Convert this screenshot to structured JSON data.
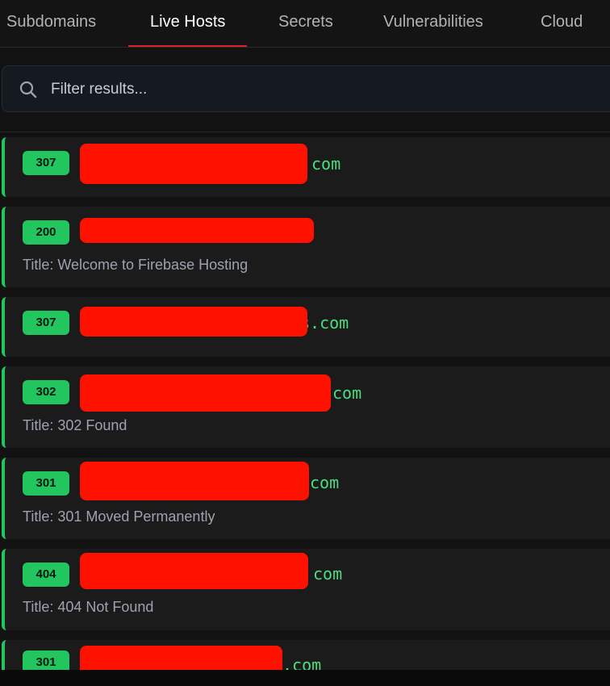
{
  "tabs": [
    {
      "label": "Subdomains",
      "active": false
    },
    {
      "label": "Live Hosts",
      "active": true
    },
    {
      "label": "Secrets",
      "active": false
    },
    {
      "label": "Vulnerabilities",
      "active": false
    },
    {
      "label": "Cloud",
      "active": false
    }
  ],
  "search": {
    "placeholder": "Filter results..."
  },
  "colors": {
    "accent_red": "#e11d2a",
    "status_green": "#22c55e",
    "redaction": "#ff1100"
  },
  "results": [
    {
      "status": "307",
      "host_suffix": "com",
      "title": ""
    },
    {
      "status": "200",
      "host_suffix": "",
      "title": "Title: Welcome to Firebase Hosting"
    },
    {
      "status": "307",
      "host_suffix": "s.com",
      "title": ""
    },
    {
      "status": "302",
      "host_suffix": "com",
      "title": "Title: 302 Found"
    },
    {
      "status": "301",
      "host_suffix": "com",
      "title": "Title: 301 Moved Permanently"
    },
    {
      "status": "404",
      "host_suffix": "com",
      "title": "Title: 404 Not Found"
    },
    {
      "status": "301",
      "host_suffix": ".com",
      "title": ""
    }
  ]
}
